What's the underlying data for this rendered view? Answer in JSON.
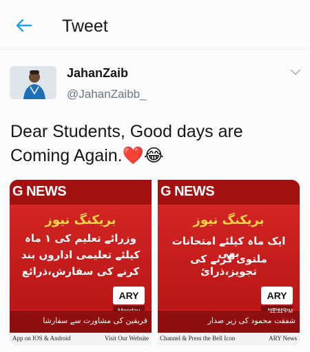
{
  "header": {
    "back_icon": "arrow-left-icon",
    "title": "Tweet",
    "accent_color": "#1da1f2"
  },
  "tweet": {
    "author_name": "JahanZaib",
    "author_handle": "@JahanZaibb_",
    "text_line1": "Dear Students, Good days are",
    "text_line2": "Coming Again.",
    "emoji_heart": "❤️",
    "emoji_laugh": "😂",
    "more_icon": "chevron-down-icon"
  },
  "media": [
    {
      "news_label": "G NEWS",
      "breaking": "بریکنگ نیوز",
      "urdu_lines": [
        "وزرائے تعلیم کی ۱ ماہ",
        "کیلئے تعلیمی اداروں بند",
        "کرنے کی سفارش،ذرائع"
      ],
      "ticker": "فریقین کی مشاورت سے سفارشا",
      "channel": "ARY",
      "sub": "Monday",
      "bottom_left": "App on IOS & Android",
      "bottom_right": "Visit Our Website"
    },
    {
      "news_label": "G NEWS",
      "breaking": "بریکنگ نیوز",
      "urdu_lines": [
        "ایک ماہ کیلئے امتحانات بھی",
        "ملتوی کرنے کی تجویز،ذرائ"
      ],
      "ticker": "شفقت محمود کی زیر صدار",
      "channel": "ARY",
      "sub": "NEWS",
      "time": "12:11 PM",
      "bottom_left": "Channel & Press the Bell Icon",
      "bottom_right": "ARY News"
    }
  ]
}
